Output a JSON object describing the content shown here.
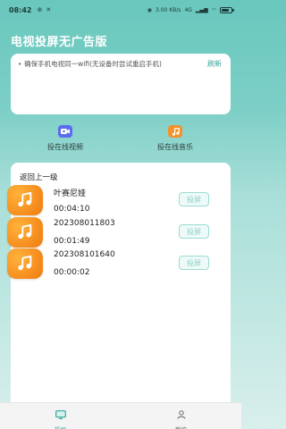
{
  "status_bar": {
    "time": "08:42",
    "left_icons": [
      "notification-icon",
      "signal-extra-icon"
    ],
    "network_speed": "3.00 KB/s",
    "network_type": "4G",
    "battery_level": 0.79
  },
  "app": {
    "title": "电视投屏无广告版"
  },
  "device_card": {
    "hint": "确保手机电视同一wifi(无设备时尝试重启手机)",
    "refresh_label": "刷新"
  },
  "shortcuts": {
    "video": {
      "label": "投在线视频",
      "icon": "video-camera-icon",
      "color": "#5b6cf0"
    },
    "music": {
      "label": "投在线音乐",
      "icon": "music-note-icon",
      "color": "#f3922c"
    }
  },
  "list": {
    "back_label": "返回上一级",
    "cast_label": "投屏",
    "items": [
      {
        "title": "叶赛尼娅",
        "duration": "00:04:10"
      },
      {
        "title": "202308011803",
        "duration": "00:01:49"
      },
      {
        "title": "202308101640",
        "duration": "00:00:02"
      }
    ]
  },
  "bottom_nav": {
    "items": [
      {
        "label": "投屏",
        "icon": "cast-tv-icon",
        "active": true
      },
      {
        "label": "我的",
        "icon": "person-icon",
        "active": false
      }
    ]
  },
  "colors": {
    "accent": "#2fa79c",
    "header_gradient_top": "#69c7bd",
    "music_icon_orange": "#f07a10"
  }
}
